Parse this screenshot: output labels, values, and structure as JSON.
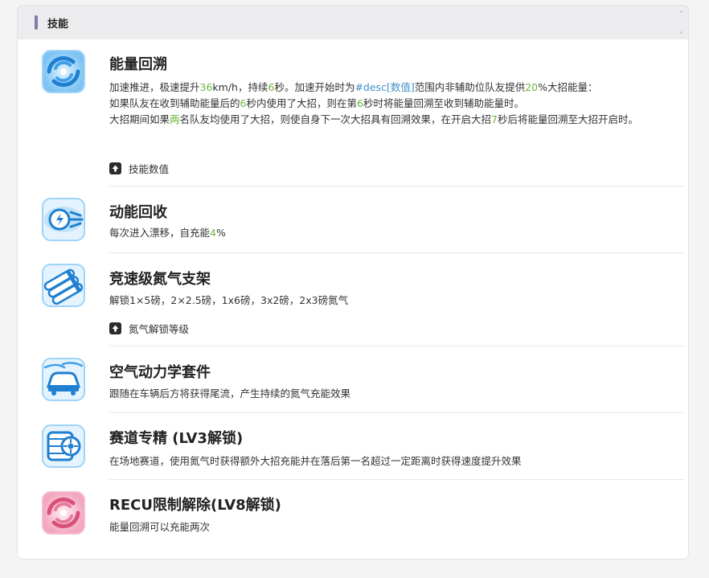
{
  "header": {
    "title": "技能"
  },
  "skills": [
    {
      "title": "能量回溯",
      "desc": {
        "p1": "加速推进，极速提升",
        "v1": "36",
        "p2": "km/h，持续",
        "v2": "6",
        "p3": "秒。加速开始时为",
        "link": "#desc[数值]",
        "p4": "范围内非辅助位队友提供",
        "v3": "20",
        "p5": "%大招能量：",
        "l2a": "如果队友在收到辅助能量后的",
        "v4": "6",
        "l2b": "秒内使用了大招，则在第",
        "v5": "6",
        "l2c": "秒时将能量回溯至收到辅助能量时。",
        "l3a": "大招期间如果",
        "v6": "两",
        "l3b": "名队友均使用了大招，则使自身下一次大招具有回溯效果，在开启大招",
        "v7": "7",
        "l3c": "秒后将能量回溯至大招开启时。"
      },
      "toggle": "技能数值",
      "icon": "vortex-icon",
      "color": "#2d8fe0"
    },
    {
      "title": "动能回收",
      "desc": {
        "p1": "每次进入漂移，自充能",
        "v1": "4",
        "p2": "%"
      },
      "icon": "energy-wheel-icon",
      "color": "#2d8fe0"
    },
    {
      "title": "竞速级氮气支架",
      "desc": {
        "p1": "解锁1×5磅，2×2.5磅，1x6磅，3x2磅，2x3磅氮气"
      },
      "toggle": "氮气解锁等级",
      "icon": "nitro-tanks-icon",
      "color": "#2d8fe0"
    },
    {
      "title": "空气动力学套件",
      "desc": {
        "p1": "跟随在车辆后方将获得尾流，产生持续的氮气充能效果"
      },
      "icon": "aero-car-icon",
      "color": "#2d8fe0"
    },
    {
      "title": "赛道专精 (LV3解锁)",
      "desc": {
        "p1": "在场地赛道，使用氮气时获得额外大招充能并在落后第一名超过一定距离时获得速度提升效果"
      },
      "icon": "tire-icon",
      "color": "#2d8fe0"
    },
    {
      "title": "RECU限制解除(LV8解锁)",
      "desc": {
        "p1": "能量回溯可以充能两次"
      },
      "icon": "vortex-pink-icon",
      "color": "#d9507a"
    }
  ]
}
